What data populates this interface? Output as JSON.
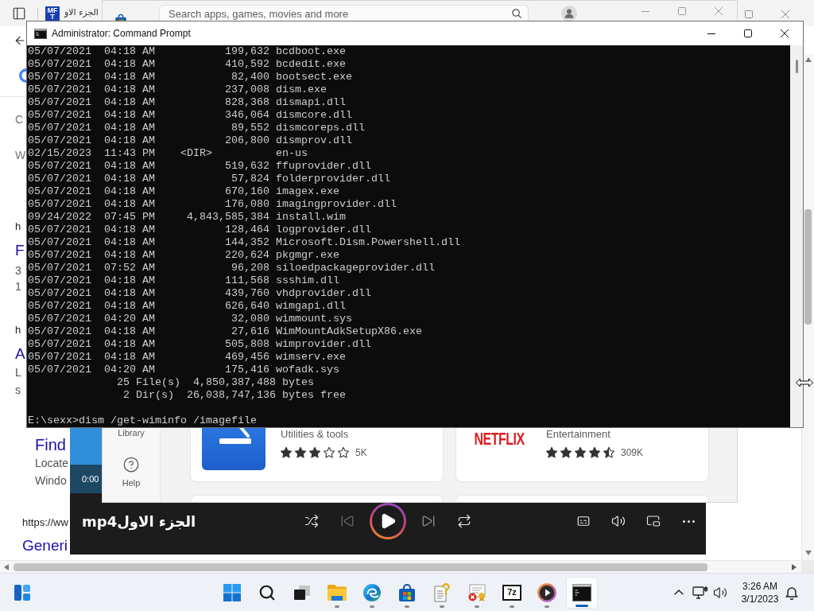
{
  "browser": {
    "tab": {
      "favicon_text": "MFT",
      "title": "الجزء الاو"
    },
    "results": [
      {
        "kind": "heading",
        "text": "C"
      },
      {
        "kind": "heading",
        "text": "W"
      },
      {
        "kind": "url",
        "text": "h"
      },
      {
        "kind": "title",
        "text": "F"
      },
      {
        "kind": "snippet",
        "text": "3"
      },
      {
        "kind": "snippet",
        "text": "1"
      },
      {
        "kind": "url",
        "text": "h"
      },
      {
        "kind": "title",
        "text": "A"
      },
      {
        "kind": "snippet",
        "text": "L"
      },
      {
        "kind": "snippet",
        "text": "s"
      },
      {
        "kind": "sublink-title",
        "text": "Find"
      },
      {
        "kind": "sublink-text",
        "text": "Locate"
      },
      {
        "kind": "sublink-text",
        "text": "Windo"
      },
      {
        "kind": "url",
        "text": "https://ww"
      },
      {
        "kind": "title",
        "text": "Generi"
      }
    ]
  },
  "store": {
    "search": {
      "placeholder": "Search apps, games, movies and more"
    },
    "nav": [
      {
        "kind": "library",
        "label": "Library"
      },
      {
        "kind": "help",
        "label": "Help"
      }
    ],
    "apps": [
      {
        "kind": "tile",
        "category": "Utilities & tools",
        "stars": 3,
        "rating_count": "5K"
      },
      {
        "kind": "wordmark",
        "logo_text": "NETFLIX",
        "category": "Entertainment",
        "stars": 4.5,
        "rating_count": "309K"
      }
    ]
  },
  "media_player": {
    "thumbnail_time": "0:00",
    "title": "mp4الجزء الاول",
    "playing": false
  },
  "command_prompt": {
    "title": "Administrator: Command Prompt",
    "lines": [
      "05/07/2021  04:18 AM           199,632 bcdboot.exe",
      "05/07/2021  04:18 AM           410,592 bcdedit.exe",
      "05/07/2021  04:18 AM            82,400 bootsect.exe",
      "05/07/2021  04:18 AM           237,008 dism.exe",
      "05/07/2021  04:18 AM           828,368 dismapi.dll",
      "05/07/2021  04:18 AM           346,064 dismcore.dll",
      "05/07/2021  04:18 AM            89,552 dismcoreps.dll",
      "05/07/2021  04:18 AM           206,800 dismprov.dll",
      "02/15/2023  11:43 PM    <DIR>          en-us",
      "05/07/2021  04:18 AM           519,632 ffuprovider.dll",
      "05/07/2021  04:18 AM            57,824 folderprovider.dll",
      "05/07/2021  04:18 AM           670,160 imagex.exe",
      "05/07/2021  04:18 AM           176,080 imagingprovider.dll",
      "09/24/2022  07:45 PM     4,843,585,384 install.wim",
      "05/07/2021  04:18 AM           128,464 logprovider.dll",
      "05/07/2021  04:18 AM           144,352 Microsoft.Dism.Powershell.dll",
      "05/07/2021  04:18 AM           220,624 pkgmgr.exe",
      "05/07/2021  07:52 AM            96,208 siloedpackageprovider.dll",
      "05/07/2021  04:18 AM           111,568 ssshim.dll",
      "05/07/2021  04:18 AM           439,760 vhdprovider.dll",
      "05/07/2021  04:18 AM           626,640 wimgapi.dll",
      "05/07/2021  04:20 AM            32,080 wimmount.sys",
      "05/07/2021  04:18 AM            27,616 WimMountAdkSetupX86.exe",
      "05/07/2021  04:18 AM           505,808 wimprovider.dll",
      "05/07/2021  04:18 AM           469,456 wimserv.exe",
      "05/07/2021  04:20 AM           175,416 wofadk.sys",
      "              25 File(s)  4,850,387,488 bytes",
      "               2 Dir(s)  26,038,747,136 bytes free"
    ],
    "prompt": "E:\\sexx>dism /get-wiminfo /imagefile"
  },
  "taskbar": {
    "apps": [
      {
        "kind": "widgets",
        "running": false,
        "selected": false
      },
      {
        "kind": "start",
        "running": false,
        "selected": false
      },
      {
        "kind": "search",
        "running": false,
        "selected": false
      },
      {
        "kind": "task-view",
        "running": false,
        "selected": false
      },
      {
        "kind": "folder",
        "running": true,
        "selected": false
      },
      {
        "kind": "swirl",
        "running": true,
        "selected": false
      },
      {
        "kind": "store",
        "running": true,
        "selected": false
      },
      {
        "kind": "help-document",
        "running": true,
        "selected": false
      },
      {
        "kind": "certificate",
        "running": true,
        "selected": false
      },
      {
        "kind": "archive",
        "label": "7z",
        "running": true,
        "selected": false
      },
      {
        "kind": "media",
        "running": true,
        "selected": false
      },
      {
        "kind": "terminal",
        "running": true,
        "selected": true
      }
    ],
    "clock": {
      "time": "3:26 AM",
      "date": "3/1/2023"
    }
  }
}
